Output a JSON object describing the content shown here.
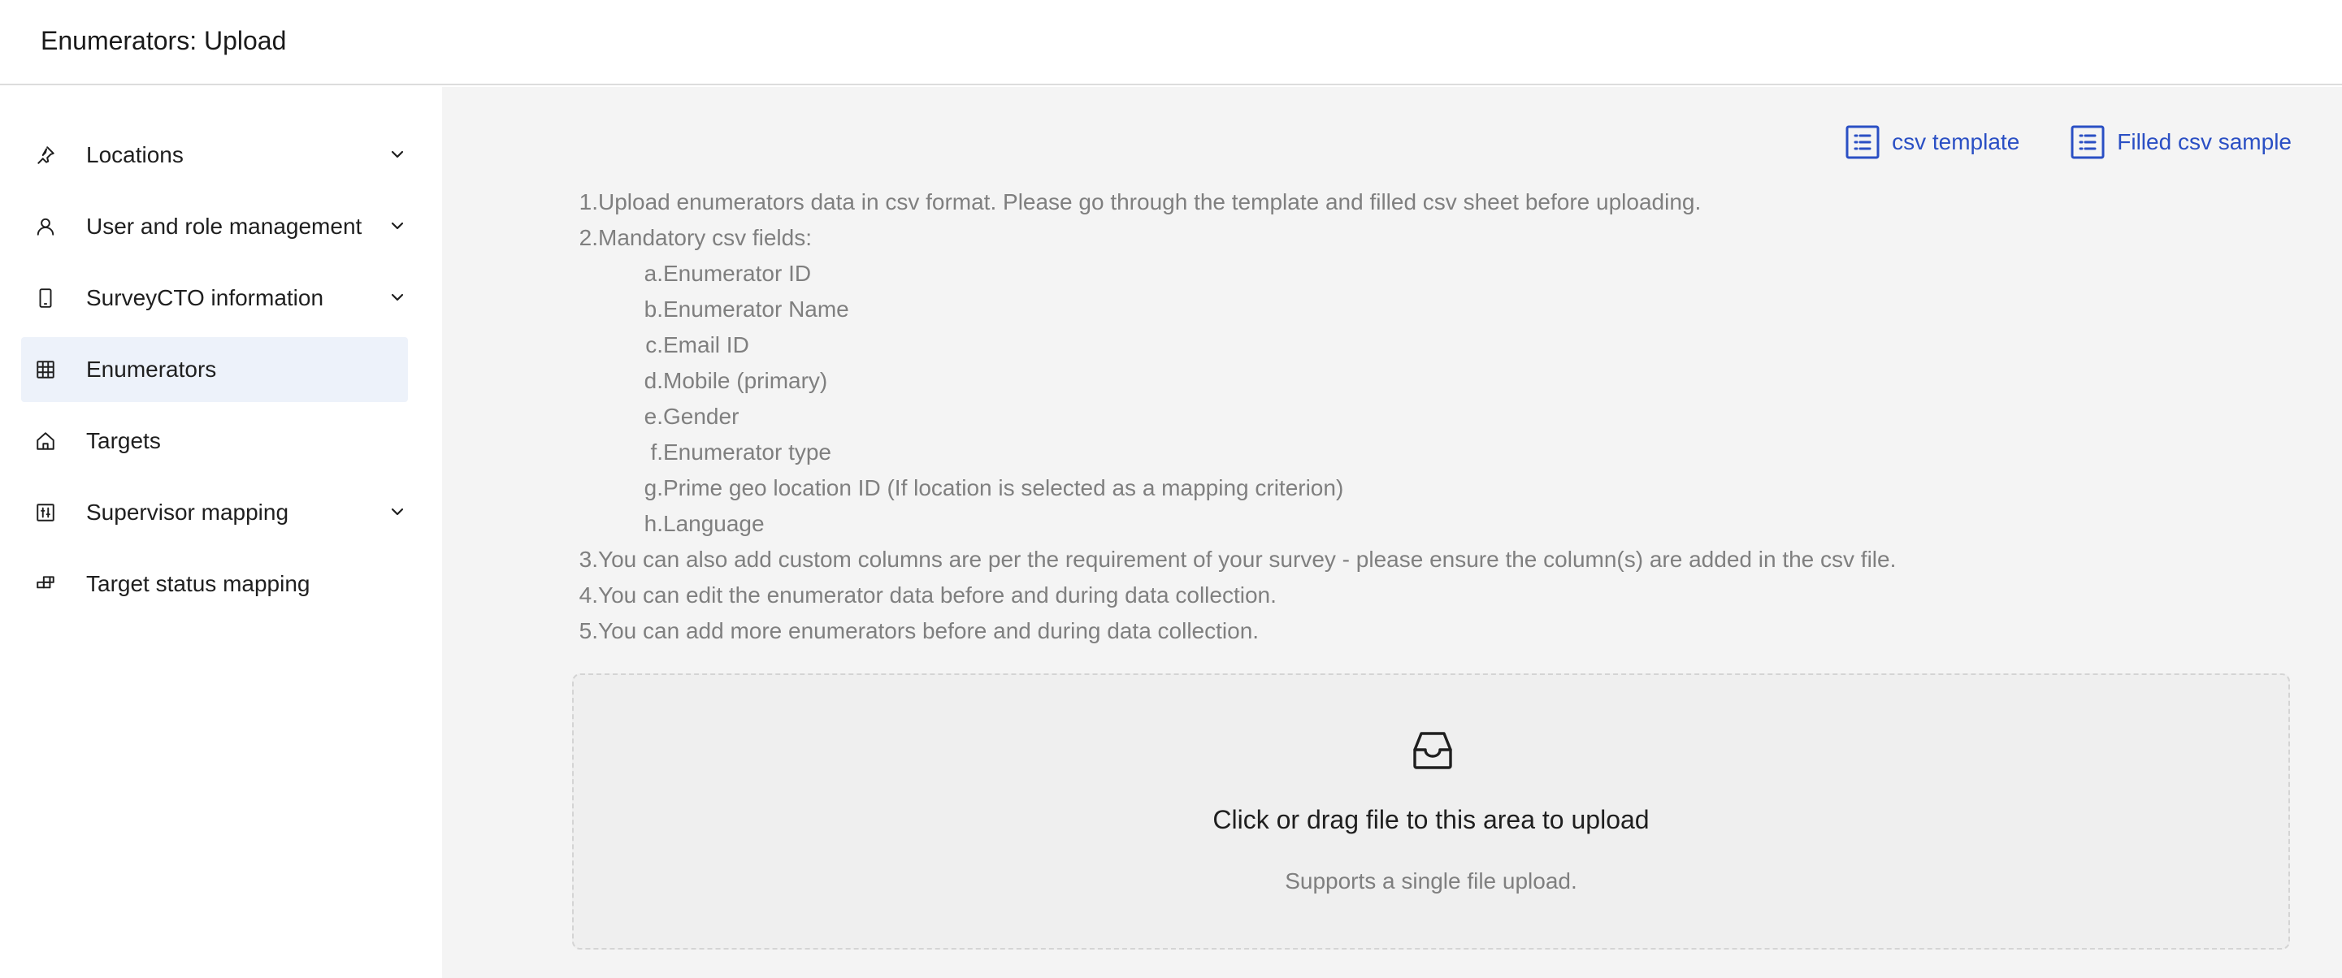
{
  "header": {
    "title": "Enumerators: Upload"
  },
  "sidebar": {
    "items": [
      {
        "label": "Locations",
        "icon": "pushpin-icon",
        "has_chevron": true,
        "active": false
      },
      {
        "label": "User and role management",
        "icon": "user-icon",
        "has_chevron": true,
        "active": false
      },
      {
        "label": "SurveyCTO information",
        "icon": "mobile-icon",
        "has_chevron": true,
        "active": false
      },
      {
        "label": "Enumerators",
        "icon": "table-icon",
        "has_chevron": false,
        "active": true
      },
      {
        "label": "Targets",
        "icon": "home-icon",
        "has_chevron": false,
        "active": false
      },
      {
        "label": "Supervisor mapping",
        "icon": "control-icon",
        "has_chevron": true,
        "active": false
      },
      {
        "label": "Target status mapping",
        "icon": "partition-icon",
        "has_chevron": false,
        "active": false
      }
    ]
  },
  "links": {
    "csv_template": "csv template",
    "filled_sample": "Filled csv sample",
    "color": "#2a4fc4"
  },
  "instructions": {
    "items": [
      {
        "num": "1.",
        "text": "Upload enumerators data in csv format. Please go through the template and filled csv sheet before uploading."
      },
      {
        "num": "2.",
        "text": "Mandatory csv fields:"
      },
      {
        "num": "3.",
        "text": "You can also add custom columns are per the requirement of your survey - please ensure the column(s) are added in the csv file."
      },
      {
        "num": "4.",
        "text": "You can edit the enumerator data before and during data collection."
      },
      {
        "num": "5.",
        "text": "You can add more enumerators before and during data collection."
      }
    ],
    "mandatory_fields": [
      {
        "num": "a.",
        "text": "Enumerator ID"
      },
      {
        "num": "b.",
        "text": "Enumerator Name"
      },
      {
        "num": "c.",
        "text": "Email ID"
      },
      {
        "num": "d.",
        "text": "Mobile (primary)"
      },
      {
        "num": "e.",
        "text": "Gender"
      },
      {
        "num": "f.",
        "text": "Enumerator type"
      },
      {
        "num": "g.",
        "text": "Prime geo location ID (If location is selected as a mapping criterion)"
      },
      {
        "num": "h.",
        "text": "Language"
      }
    ]
  },
  "upload": {
    "title": "Click or drag file to this area to upload",
    "hint": "Supports a single file upload.",
    "icon": "inbox-icon"
  }
}
